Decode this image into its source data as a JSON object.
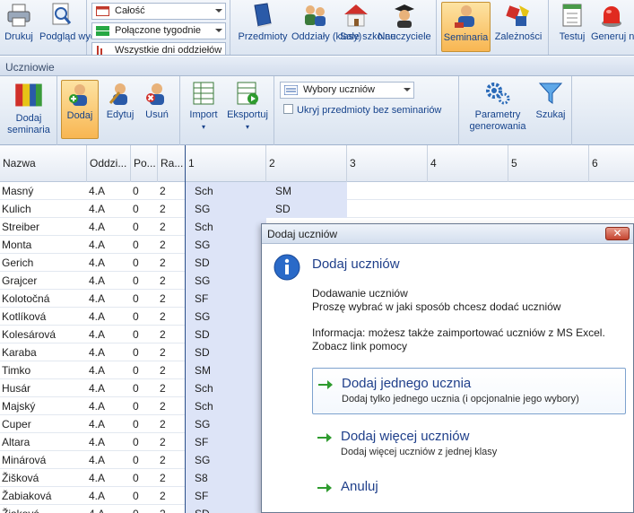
{
  "ribbon_top": {
    "print_label": "Drukuj",
    "preview_label": "Podgląd wydruku",
    "filter_1": "Całość",
    "filter_2": "Połączone tygodnie",
    "filter_3": "Wszystkie dni oddziełów",
    "subjects_label": "Przedmioty",
    "classes_label": "Oddziały (klasy)",
    "rooms_label": "Sale szkolne",
    "teachers_label": "Nauczyciele",
    "seminars_label": "Seminaria",
    "dependencies_label": "Zależności",
    "test_label": "Testuj",
    "generate_label": "Generuj nowy"
  },
  "section_title": "Uczniowie",
  "ribbon_students": {
    "add_seminars_label": "Dodaj seminaria",
    "add_label": "Dodaj",
    "edit_label": "Edytuj",
    "delete_label": "Usuń",
    "import_label": "Import",
    "export_label": "Eksportuj",
    "choices_select": "Wybory uczniów",
    "hide_subjects_label": "Ukryj przedmioty bez seminariów",
    "params_label": "Parametry generowania",
    "search_label": "Szukaj"
  },
  "grid": {
    "headers": [
      "Nazwa",
      "Oddzi...",
      "Po...",
      "Ra...",
      "1",
      "2",
      "3",
      "4",
      "5",
      "6"
    ],
    "rows": [
      {
        "name": "Masný",
        "cls": "4.A",
        "po": "0",
        "ra": "2",
        "c1": "Sch",
        "c2": "SM"
      },
      {
        "name": "Kulich",
        "cls": "4.A",
        "po": "0",
        "ra": "2",
        "c1": "SG",
        "c2": "SD"
      },
      {
        "name": "Streiber",
        "cls": "4.A",
        "po": "0",
        "ra": "2",
        "c1": "Sch",
        "c2": ""
      },
      {
        "name": "Monta",
        "cls": "4.A",
        "po": "0",
        "ra": "2",
        "c1": "SG",
        "c2": ""
      },
      {
        "name": "Gerich",
        "cls": "4.A",
        "po": "0",
        "ra": "2",
        "c1": "SD",
        "c2": ""
      },
      {
        "name": "Grajcer",
        "cls": "4.A",
        "po": "0",
        "ra": "2",
        "c1": "SG",
        "c2": ""
      },
      {
        "name": "Kolotočná",
        "cls": "4.A",
        "po": "0",
        "ra": "2",
        "c1": "SF",
        "c2": ""
      },
      {
        "name": "Kotlíková",
        "cls": "4.A",
        "po": "0",
        "ra": "2",
        "c1": "SG",
        "c2": ""
      },
      {
        "name": "Kolesárová",
        "cls": "4.A",
        "po": "0",
        "ra": "2",
        "c1": "SD",
        "c2": ""
      },
      {
        "name": "Karaba",
        "cls": "4.A",
        "po": "0",
        "ra": "2",
        "c1": "SD",
        "c2": ""
      },
      {
        "name": "Timko",
        "cls": "4.A",
        "po": "0",
        "ra": "2",
        "c1": "SM",
        "c2": ""
      },
      {
        "name": "Husár",
        "cls": "4.A",
        "po": "0",
        "ra": "2",
        "c1": "Sch",
        "c2": ""
      },
      {
        "name": "Majský",
        "cls": "4.A",
        "po": "0",
        "ra": "2",
        "c1": "Sch",
        "c2": ""
      },
      {
        "name": "Cuper",
        "cls": "4.A",
        "po": "0",
        "ra": "2",
        "c1": "SG",
        "c2": ""
      },
      {
        "name": "Altara",
        "cls": "4.A",
        "po": "0",
        "ra": "2",
        "c1": "SF",
        "c2": ""
      },
      {
        "name": "Minárová",
        "cls": "4.A",
        "po": "0",
        "ra": "2",
        "c1": "SG",
        "c2": ""
      },
      {
        "name": "Žišková",
        "cls": "4.A",
        "po": "0",
        "ra": "2",
        "c1": "S8",
        "c2": ""
      },
      {
        "name": "Žabiaková",
        "cls": "4.A",
        "po": "0",
        "ra": "2",
        "c1": "SF",
        "c2": ""
      },
      {
        "name": "Žiaková",
        "cls": "4.A",
        "po": "0",
        "ra": "2",
        "c1": "SD",
        "c2": ""
      }
    ]
  },
  "dialog": {
    "title": "Dodaj uczniów",
    "heading": "Dodaj uczniów",
    "line1": "Dodawanie uczniów",
    "line2": "Proszę wybrać w jaki sposób chcesz dodać uczniów",
    "line3": "Informacja: możesz także zaimportować uczniów z MS Excel.",
    "line4": "Zobacz link pomocy",
    "opt1_title": "Dodaj jednego ucznia",
    "opt1_desc": "Dodaj tylko jednego ucznia (i opcjonalnie jego wybory)",
    "opt2_title": "Dodaj więcej uczniów",
    "opt2_desc": "Dodaj więcej uczniów z jednej klasy",
    "cancel": "Anuluj",
    "close_glyph": "✕"
  },
  "colors": {
    "accent_active": "#f8b652",
    "link_blue": "#1f3f8a",
    "column_highlight": "#dde4f7",
    "arrow_green": "#2e9b2e"
  }
}
